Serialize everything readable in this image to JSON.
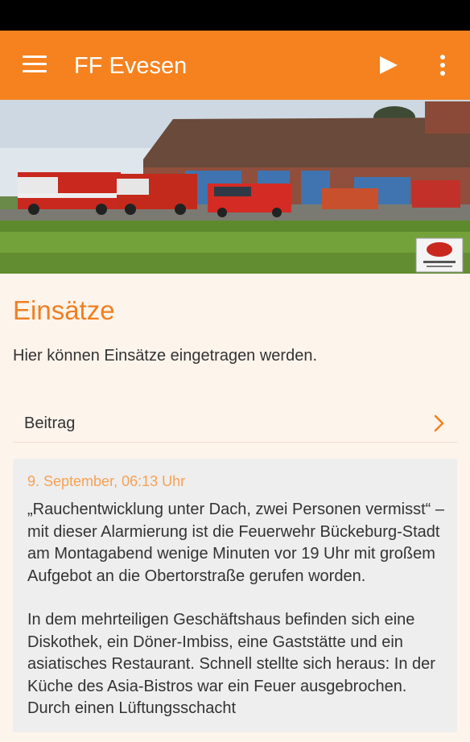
{
  "appbar": {
    "title": "FF Evesen",
    "icons": {
      "menu": "menu-icon",
      "play": "play-icon",
      "more": "more-vert-icon"
    }
  },
  "banner": {
    "description_icon": "fire-station-photo",
    "logo": "fire-department-logo"
  },
  "section": {
    "title": "Einsätze",
    "description": "Hier können Einsätze eingetragen werden."
  },
  "post_button": {
    "label": "Beitrag",
    "icon": "chevron-right-icon"
  },
  "card": {
    "date": "9. September, 06:13 Uhr",
    "paragraphs": [
      "„Rauchentwicklung unter Dach, zwei Personen vermisst“ – mit dieser Alarmierung ist die Feuerwehr Bückeburg-Stadt am Montagabend wenige Minuten vor 19 Uhr mit großem Aufgebot an die Obertorstraße gerufen worden.",
      "In dem mehrteiligen Geschäftshaus befinden sich eine Diskothek, ein Döner-Imbiss, eine Gaststätte und ein asiatisches Restaurant. Schnell stellte sich heraus: In der Küche des Asia-Bistros war ein Feuer ausgebrochen. Durch einen Lüftungsschacht"
    ]
  },
  "colors": {
    "accent": "#f5821f",
    "title_orange": "#f07f20",
    "date_orange": "#f5a255",
    "background": "#fdf4ec",
    "card": "#eeeeee"
  }
}
